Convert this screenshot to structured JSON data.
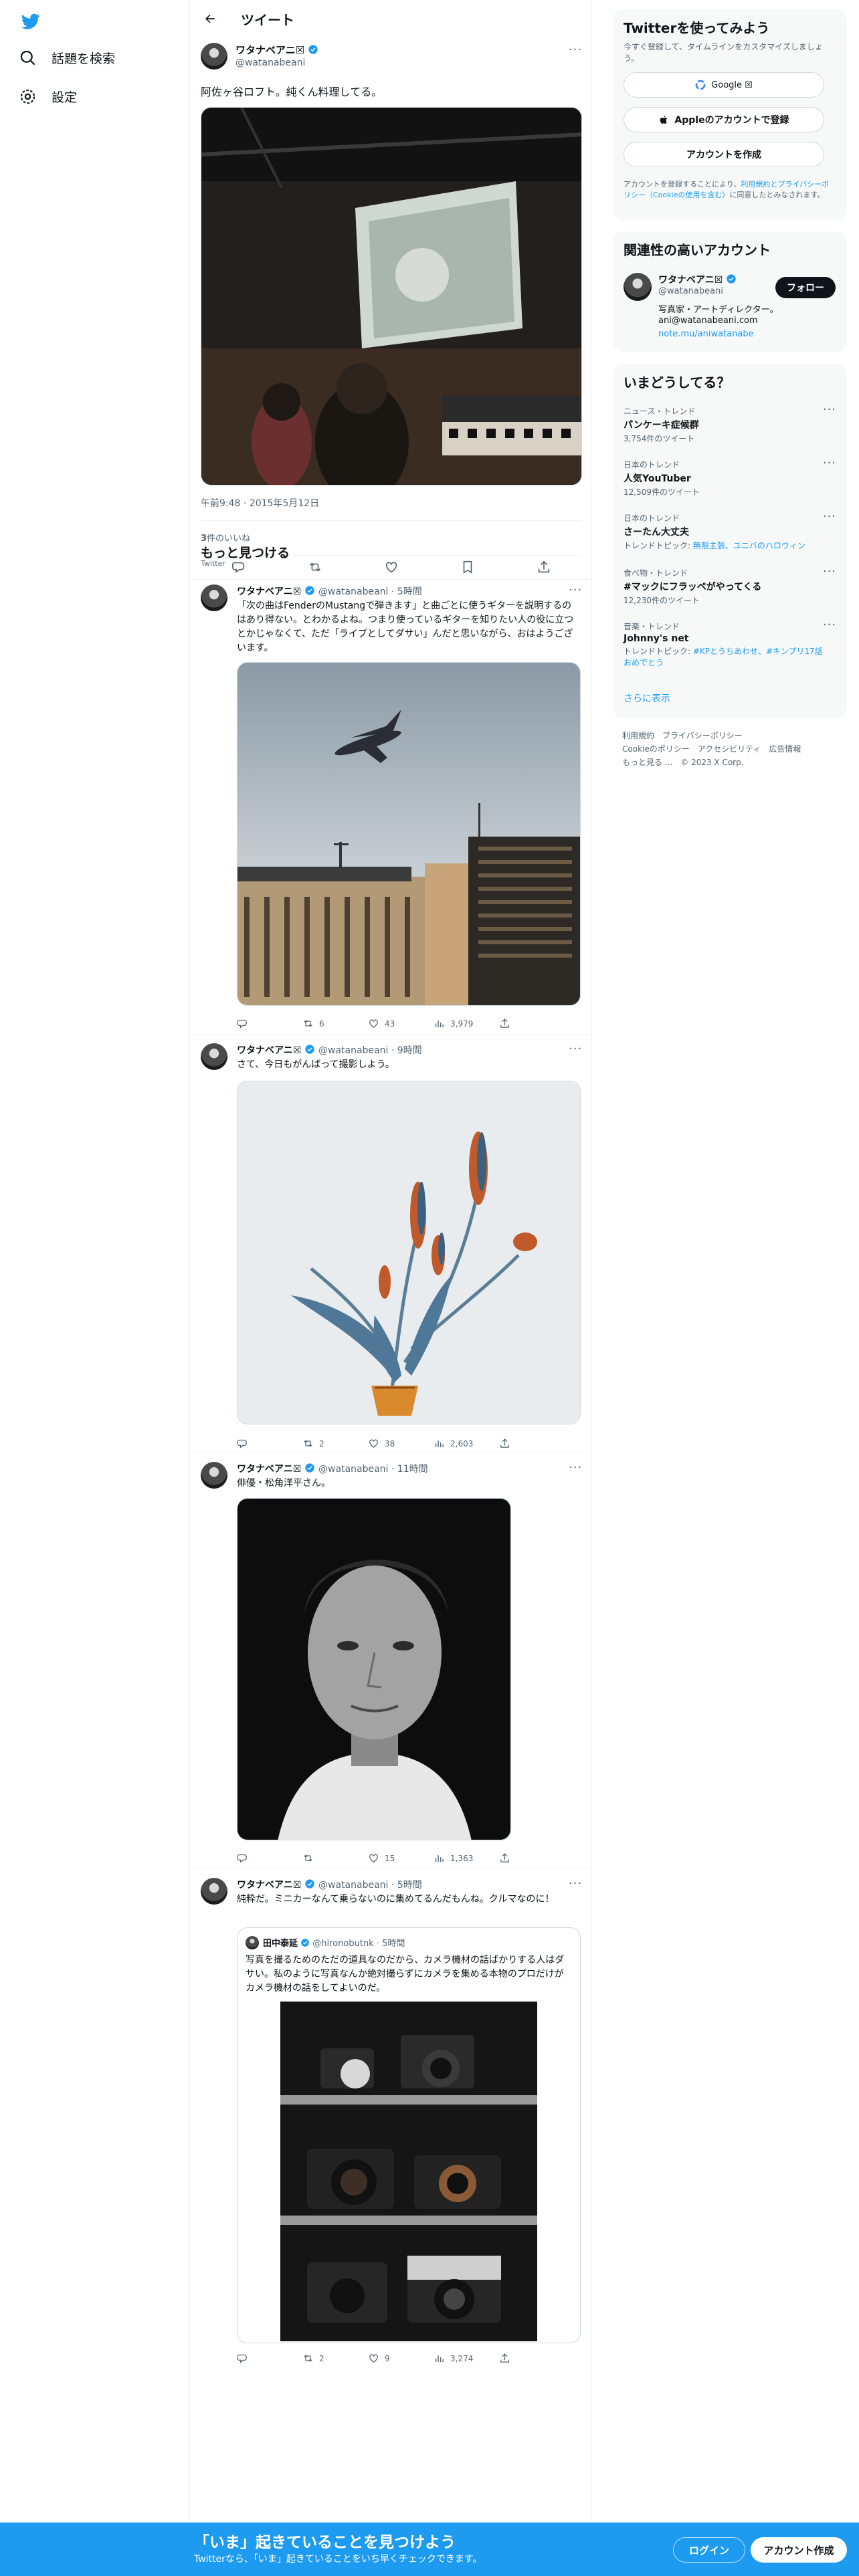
{
  "nav": {
    "items": [
      {
        "label": "話題を検索",
        "icon": "search-icon"
      },
      {
        "label": "設定",
        "icon": "gear-icon"
      }
    ]
  },
  "header": {
    "title": "ツイート"
  },
  "main_tweet": {
    "name": "ワタナベアニ",
    "name_suffix": "☒",
    "handle": "@watanabeani",
    "text": "阿佐ヶ谷ロフト。純くん料理してる。",
    "time": "午前9:48",
    "date": "2015年5月12日",
    "likes_count": "3",
    "likes_label": "件のいいね"
  },
  "more": {
    "title": "もっと見つける",
    "subtitle": "Twitter"
  },
  "feed": [
    {
      "name": "ワタナベアニ☒",
      "handle": "@watanabeani",
      "time": "5時間",
      "text": "「次の曲はFenderのMustangで弾きます」と曲ごとに使うギターを説明するのはあり得ない。とわかるよね。つまり使っているギターを知りたい人の役に立つとかじゃなくて、ただ「ライブとしてダサい」んだと思いながら、おはようございます。",
      "retweets": "6",
      "likes": "43",
      "views": "3,979"
    },
    {
      "name": "ワタナベアニ☒",
      "handle": "@watanabeani",
      "time": "9時間",
      "text": "さて、今日もがんばって撮影しよう。",
      "retweets": "2",
      "likes": "38",
      "views": "2,603"
    },
    {
      "name": "ワタナベアニ☒",
      "handle": "@watanabeani",
      "time": "11時間",
      "text": "俳優・松角洋平さん。",
      "retweets": "",
      "likes": "15",
      "views": "1,363"
    },
    {
      "name": "ワタナベアニ☒",
      "handle": "@watanabeani",
      "time": "5時間",
      "text": "純粋だ。ミニカーなんて乗らないのに集めてるんだもんね。クルマなのに！",
      "retweets": "2",
      "likes": "9",
      "views": "3,274",
      "quote": {
        "name": "田中泰延",
        "handle": "@hironobutnk",
        "time": "5時間",
        "text": "写真を撮るためのただの道具なのだから、カメラ機材の話ばかりする人はダサい。私のように写真なんか絶対撮らずにカメラを集める本物のプロだけがカメラ機材の話をしてよいのだ。"
      }
    }
  ],
  "signup": {
    "title": "Twitterを使ってみよう",
    "subtitle": "今すぐ登録して、タイムラインをカスタマイズしましょう。",
    "google": "Google ☒",
    "apple": "Appleのアカウントで登録",
    "create": "アカウントを作成",
    "terms_pre": "アカウントを登録することにより、",
    "terms_link": "利用規約とプライバシーポリシー（Cookieの使用を含む）",
    "terms_post": "に同意したとみなされます。"
  },
  "related": {
    "title": "関連性の高いアカウント",
    "name": "ワタナベアニ☒",
    "handle": "@watanabeani",
    "bio": "写真家・アートディレクター。",
    "email": "ani@watanabeani.com",
    "link": "note.mu/aniwatanabe",
    "follow": "フォロー"
  },
  "trends": {
    "title": "いまどうしてる？",
    "items": [
      {
        "category": "ニュース・トレンド",
        "name": "パンケーキ症候群",
        "count": "3,754件のツイート"
      },
      {
        "category": "日本のトレンド",
        "name": "人気YouTuber",
        "count": "12,509件のツイート"
      },
      {
        "category": "日本のトレンド",
        "name": "さーたん大丈夫",
        "count": "トレンドトピック: ",
        "count_link": "無限主張、ユニバのハロウィン"
      },
      {
        "category": "食べ物・トレンド",
        "name": "#マックにフラッペがやってくる",
        "count": "12,230件のツイート"
      },
      {
        "category": "音楽・トレンド",
        "name": "Johnny's net",
        "count": "トレンドトピック: ",
        "count_link": "#KPとうちあわせ、#キンプリ17話おめでとう"
      }
    ],
    "show_more": "さらに表示"
  },
  "footer": {
    "line1": "利用規約　プライバシーポリシー",
    "line2": "Cookieのポリシー　アクセシビリティ　広告情報",
    "line3": "もっと見る ...　© 2023 X Corp."
  },
  "bottom": {
    "title": "「いま」起きていることを見つけよう",
    "subtitle": "Twitterなら、「いま」起きていることをいち早くチェックできます。",
    "login": "ログイン",
    "signup": "アカウント作成"
  },
  "colors": {
    "accent": "#1d9bf0",
    "text": "#0f1419",
    "muted": "#536471",
    "border": "#eff3f4"
  }
}
